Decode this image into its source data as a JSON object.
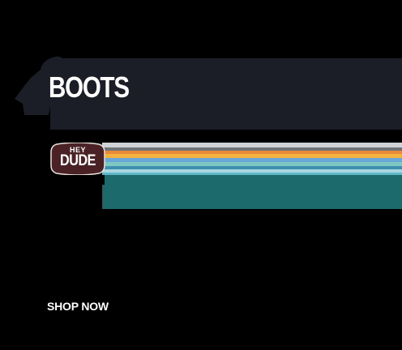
{
  "promo": {
    "headline": "BOOTS",
    "brand": {
      "line1": "HEY",
      "line2": "DUDE"
    },
    "cta_label": "SHOP NOW"
  },
  "colors": {
    "background": "#000000",
    "band": "#1b1e26",
    "logo_badge": "#4a2226",
    "teal": "#1c6a6b",
    "stripes": [
      "#d8dde3",
      "#e88a3a",
      "#f4b23e",
      "#6aa7d9",
      "#7ec8c4",
      "#3f8fb0",
      "#a9d6df",
      "#5fb6c8"
    ]
  },
  "icons": {
    "silhouette": "figure-silhouette-icon",
    "logo": "hey-dude-logo"
  }
}
